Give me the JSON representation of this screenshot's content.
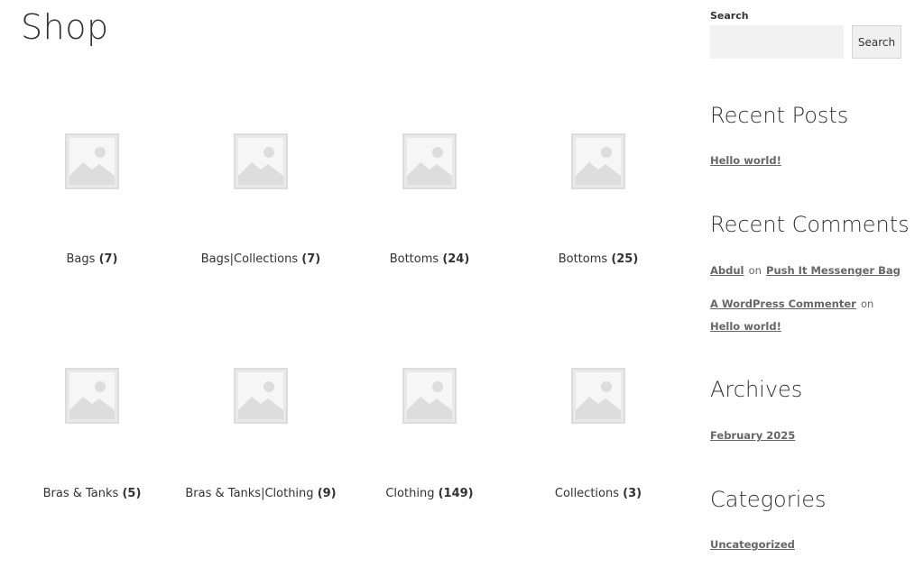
{
  "page": {
    "title": "Shop"
  },
  "categories": [
    {
      "name": "Bags",
      "count": "(7)"
    },
    {
      "name": "Bags|Collections",
      "count": "(7)"
    },
    {
      "name": "Bottoms",
      "count": "(24)"
    },
    {
      "name": "Bottoms",
      "count": "(25)"
    },
    {
      "name": "Bras & Tanks",
      "count": "(5)"
    },
    {
      "name": "Bras & Tanks|Clothing",
      "count": "(9)"
    },
    {
      "name": "Clothing",
      "count": "(149)"
    },
    {
      "name": "Collections",
      "count": "(3)"
    }
  ],
  "sidebar": {
    "search": {
      "label": "Search",
      "placeholder": "",
      "value": "",
      "button_label": "Search"
    },
    "recent_posts": {
      "title": "Recent Posts",
      "items": [
        "Hello world!"
      ]
    },
    "recent_comments": {
      "title": "Recent Comments",
      "items": [
        {
          "author": "Abdul",
          "on": "on",
          "post": "Push It Messenger Bag"
        },
        {
          "author": "A WordPress Commenter",
          "on": "on",
          "post": "Hello world!"
        }
      ]
    },
    "archives": {
      "title": "Archives",
      "items": [
        "February 2025"
      ]
    },
    "categories": {
      "title": "Categories",
      "items": [
        "Uncategorized"
      ]
    }
  },
  "colors": {
    "placeholder_fill": "#e6e6e6",
    "placeholder_stroke": "#d9d9d9",
    "link": "#666666",
    "text": "#333333"
  }
}
